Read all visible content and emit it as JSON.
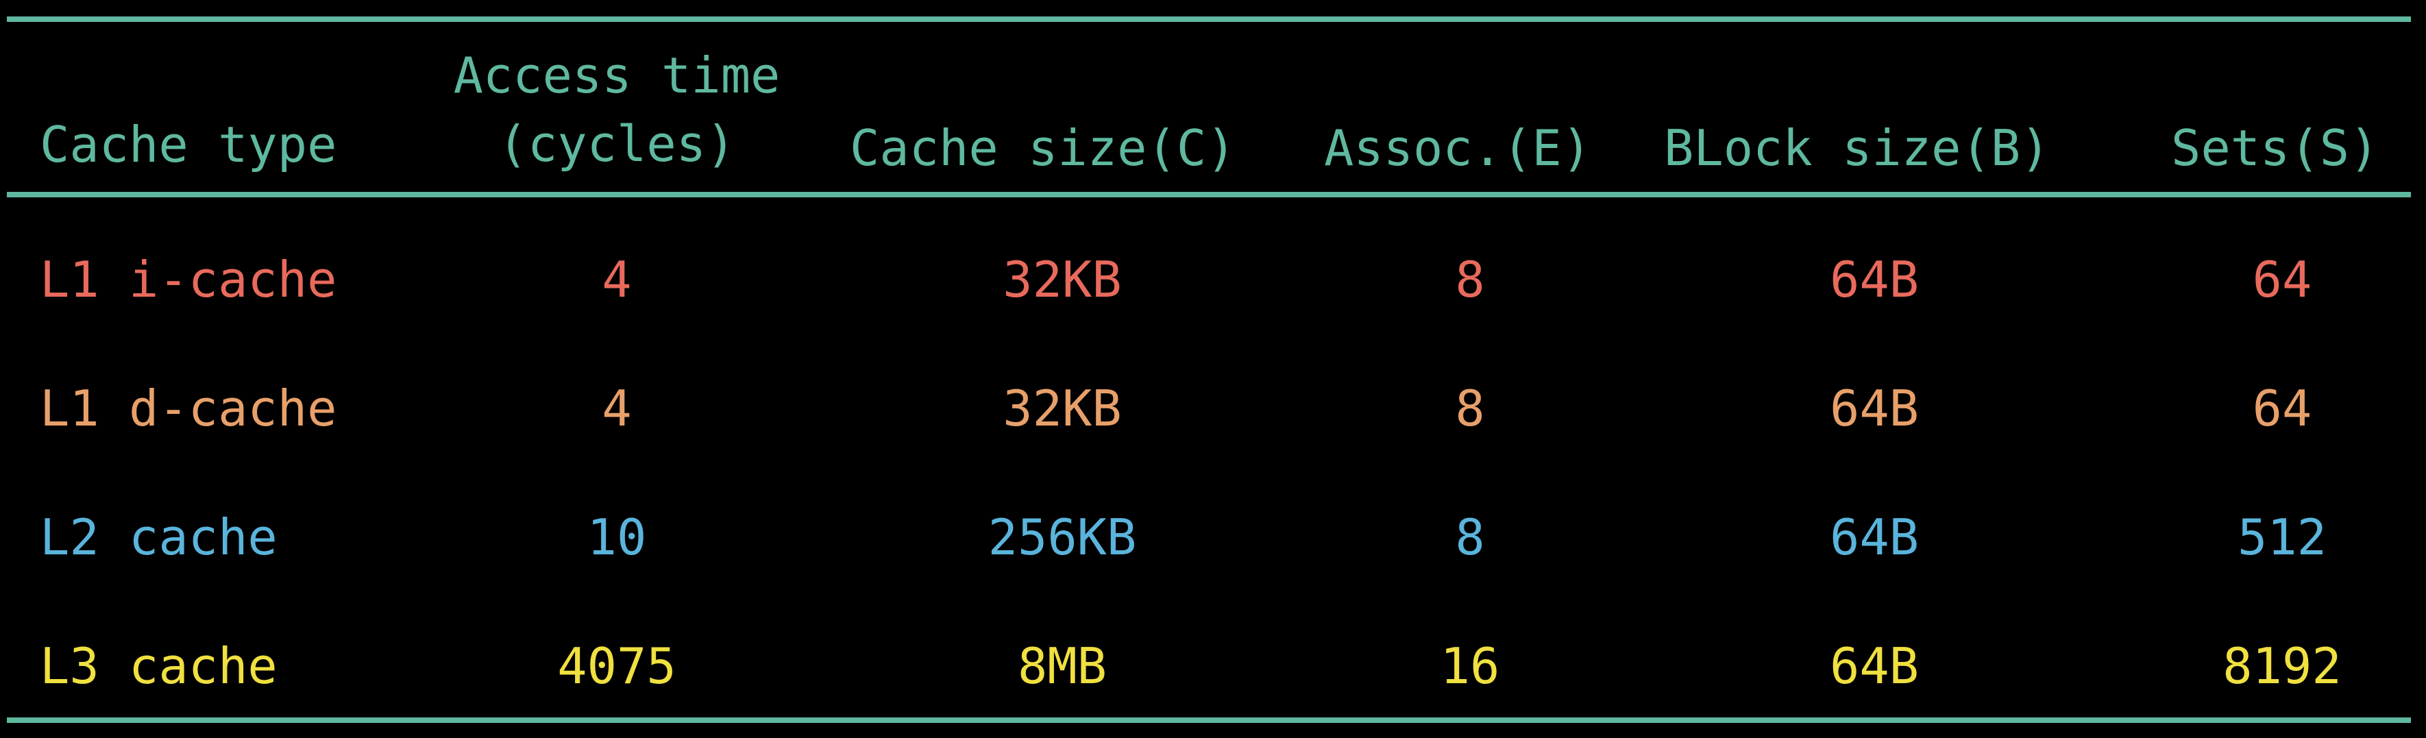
{
  "colors": {
    "background": "#000000",
    "rule": "#5fb8a0",
    "header": "#5fb8a0",
    "row_l1i": "#e86a5c",
    "row_l1d": "#e8a06a",
    "row_l2": "#5ab4dc",
    "row_l3": "#f0e040"
  },
  "headers": {
    "cache_type": "Cache type",
    "access_time_line1": "Access time",
    "access_time_line2": "(cycles)",
    "cache_size": "Cache size(C)",
    "assoc": "Assoc.(E)",
    "block_size": "BLock size(B)",
    "sets": "Sets(S)"
  },
  "rows": [
    {
      "type": "L1 i-cache",
      "access": "4",
      "size": "32KB",
      "assoc": "8",
      "block": "64B",
      "sets": "64",
      "color": "#e86a5c"
    },
    {
      "type": "L1 d-cache",
      "access": "4",
      "size": "32KB",
      "assoc": "8",
      "block": "64B",
      "sets": "64",
      "color": "#e8a06a"
    },
    {
      "type": "L2 cache",
      "access": "10",
      "size": "256KB",
      "assoc": "8",
      "block": "64B",
      "sets": "512",
      "color": "#5ab4dc"
    },
    {
      "type": "L3 cache",
      "access": "4075",
      "size": "8MB",
      "assoc": "16",
      "block": "64B",
      "sets": "8192",
      "color": "#f0e040"
    }
  ]
}
